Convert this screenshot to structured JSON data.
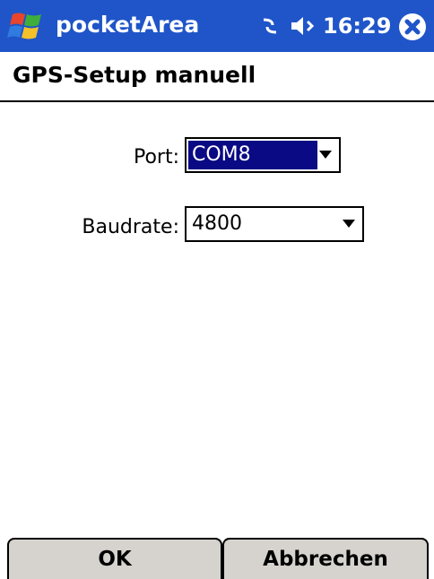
{
  "titlebar": {
    "app_title": "pocketArea",
    "time": "16:29",
    "start_icon": "windows-flag-icon",
    "connectivity_icon": "connectivity-icon",
    "volume_icon": "speaker-icon",
    "close_icon": "close-icon"
  },
  "page": {
    "title": "GPS-Setup manuell"
  },
  "form": {
    "port_label": "Port:",
    "port_value": "COM8",
    "baudrate_label": "Baudrate:",
    "baudrate_value": "4800"
  },
  "buttons": {
    "ok_label": "OK",
    "cancel_label": "Abbrechen"
  },
  "colors": {
    "titlebar": "#1f55c8",
    "selection": "#0a0a84",
    "button_face": "#d6d3ce"
  }
}
